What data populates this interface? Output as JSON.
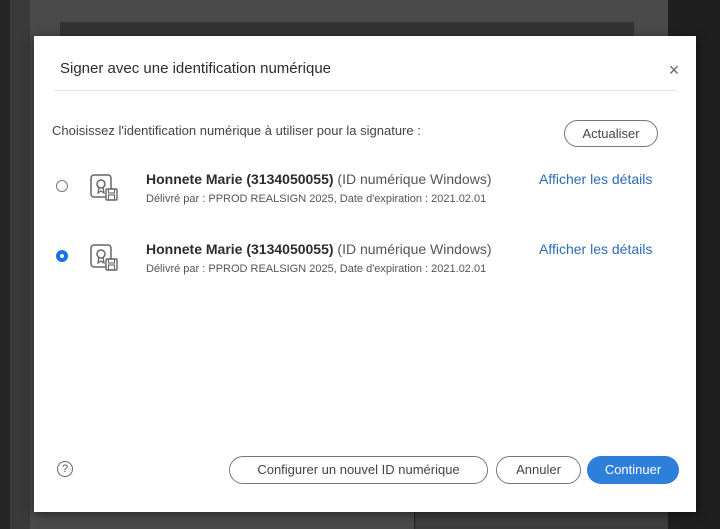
{
  "dialog": {
    "title": "Signer avec une identification numérique",
    "close_symbol": "×",
    "prompt": "Choisissez l'identification numérique à utiliser pour la signature :",
    "refresh_label": "Actualiser"
  },
  "identities": [
    {
      "selected": false,
      "name": "Honnete Marie (3134050055)",
      "type": " (ID numérique Windows)",
      "details_link": "Afficher les détails",
      "issuer": "Délivré par : PPROD REALSIGN 2025, Date d'expiration : 2021.02.01",
      "icon": "certificate-icon"
    },
    {
      "selected": true,
      "name": "Honnete Marie (3134050055)",
      "type": " (ID numérique Windows)",
      "details_link": "Afficher les détails",
      "issuer": "Délivré par : PPROD REALSIGN 2025, Date d'expiration : 2021.02.01",
      "icon": "certificate-icon"
    }
  ],
  "footer": {
    "help_symbol": "?",
    "configure_label": "Configurer un nouvel ID numérique",
    "cancel_label": "Annuler",
    "continue_label": "Continuer"
  },
  "colors": {
    "accent": "#1473e6",
    "continue_button": "#2e7fd9",
    "link": "#2d6db5"
  }
}
